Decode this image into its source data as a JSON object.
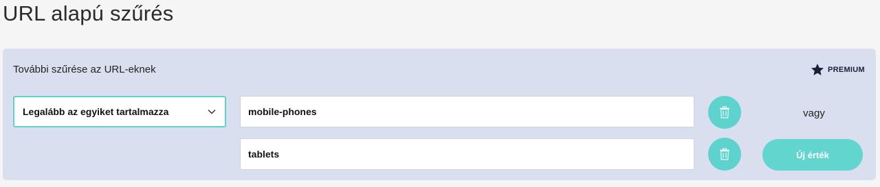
{
  "page": {
    "title": "URL alapú szűrés"
  },
  "panel": {
    "heading": "További szűrése az URL-eknek",
    "premium": {
      "label": "PREMIUM",
      "icon": "star-icon"
    },
    "condition_select": {
      "selected": "Legalább az egyiket tartalmazza",
      "icon": "chevron-down-icon"
    },
    "values": [
      {
        "value": "mobile-phones",
        "delete_icon": "trash-icon"
      },
      {
        "value": "tablets",
        "delete_icon": "trash-icon"
      }
    ],
    "or_label": "vagy",
    "new_value_button": "Új érték"
  },
  "colors": {
    "accent": "#5ed2cc",
    "panel_bg": "#dadff0",
    "page_bg": "#f5f5f5",
    "premium": "#1a1f3a"
  }
}
